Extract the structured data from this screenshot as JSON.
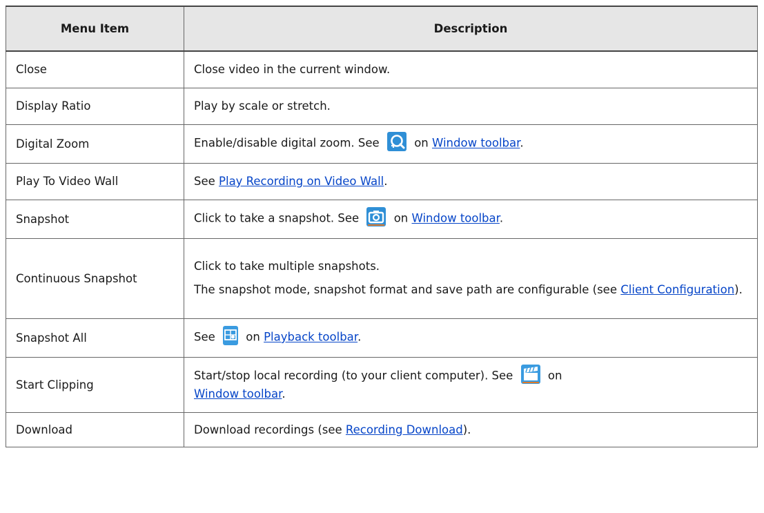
{
  "table": {
    "header": {
      "menu_item": "Menu Item",
      "description": "Description"
    },
    "rows": [
      {
        "item": "Close",
        "desc": "Close video in the current window."
      },
      {
        "item": "Display Ratio",
        "desc": "Play by scale or stretch."
      },
      {
        "item": "Digital Zoom",
        "desc_before": "Enable/disable digital zoom. See",
        "desc_mid": "on",
        "link": "Window toolbar",
        "desc_after": ".",
        "icon": "digital-zoom-icon"
      },
      {
        "item": "Play To Video Wall",
        "desc_before": "See",
        "link": "Play Recording on Video Wall",
        "desc_after": "."
      },
      {
        "item": "Snapshot",
        "desc_before": "Click to take a snapshot. See",
        "desc_mid": "on",
        "link": "Window toolbar",
        "desc_after": ".",
        "icon": "camera-icon"
      },
      {
        "item": "Continuous Snapshot",
        "desc_line1": "Click to take multiple snapshots.",
        "desc_before": "The snapshot mode, snapshot format and save path are configurable (see",
        "link": "Client Configuration",
        "desc_after": ")."
      },
      {
        "item": "Snapshot All",
        "desc_before": "See",
        "desc_mid": "on",
        "link": "Playback toolbar",
        "desc_after": ".",
        "icon": "snapshot-all-icon"
      },
      {
        "item": "Start Clipping",
        "desc_before": "Start/stop local recording (to your client computer). See",
        "desc_mid": "on",
        "link": "Window toolbar",
        "desc_after": ".",
        "icon": "clapperboard-icon"
      },
      {
        "item": "Download",
        "desc_before": "Download recordings (see",
        "link": "Recording Download",
        "desc_after": ")."
      }
    ]
  },
  "colors": {
    "icon_blue": "#2f8fd6",
    "link": "#0645c8",
    "header_bg": "#e6e6e6"
  }
}
